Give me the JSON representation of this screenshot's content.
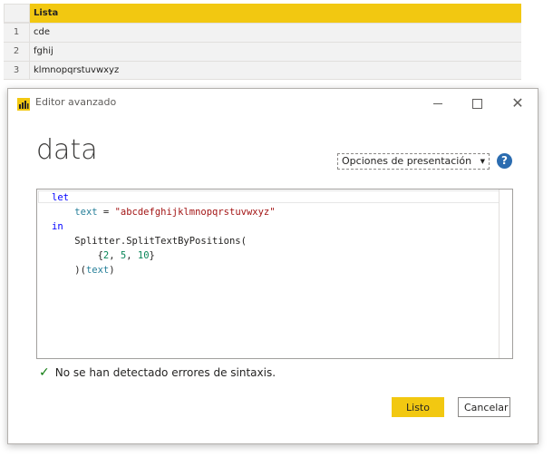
{
  "table": {
    "column": "Lista",
    "rows": [
      {
        "num": "1",
        "value": "cde"
      },
      {
        "num": "2",
        "value": "fghij"
      },
      {
        "num": "3",
        "value": "klmnopqrstuvwxyz"
      }
    ]
  },
  "dialog": {
    "title": "Editor avanzado",
    "query_name": "data",
    "options_label": "Opciones de presentación",
    "help_label": "?",
    "status": "No se han detectado errores de sintaxis.",
    "ok_label": "Listo",
    "cancel_label": "Cancelar"
  },
  "code": {
    "l1_kw": "let",
    "l2_id": "text",
    "l2_eq": " = ",
    "l2_str": "\"abcdefghijklmnopqrstuvwxyz\"",
    "l3_kw": "in",
    "l4_fn": "Splitter.SplitTextByPositions(",
    "l5_open": "{",
    "l5_n1": "2",
    "l5_n2": "5",
    "l5_n3": "10",
    "l5_close": "}",
    "l6_open": ")(",
    "l6_id": "text",
    "l6_close": ")"
  },
  "colors": {
    "accent": "#f2c811",
    "keyword": "#0000ff",
    "string": "#a31515",
    "number": "#098658",
    "success": "#107c10"
  },
  "icons": [
    "powerbi-logo-icon",
    "minimize-icon",
    "maximize-icon",
    "close-icon",
    "caret-down-icon",
    "help-icon",
    "check-icon"
  ]
}
